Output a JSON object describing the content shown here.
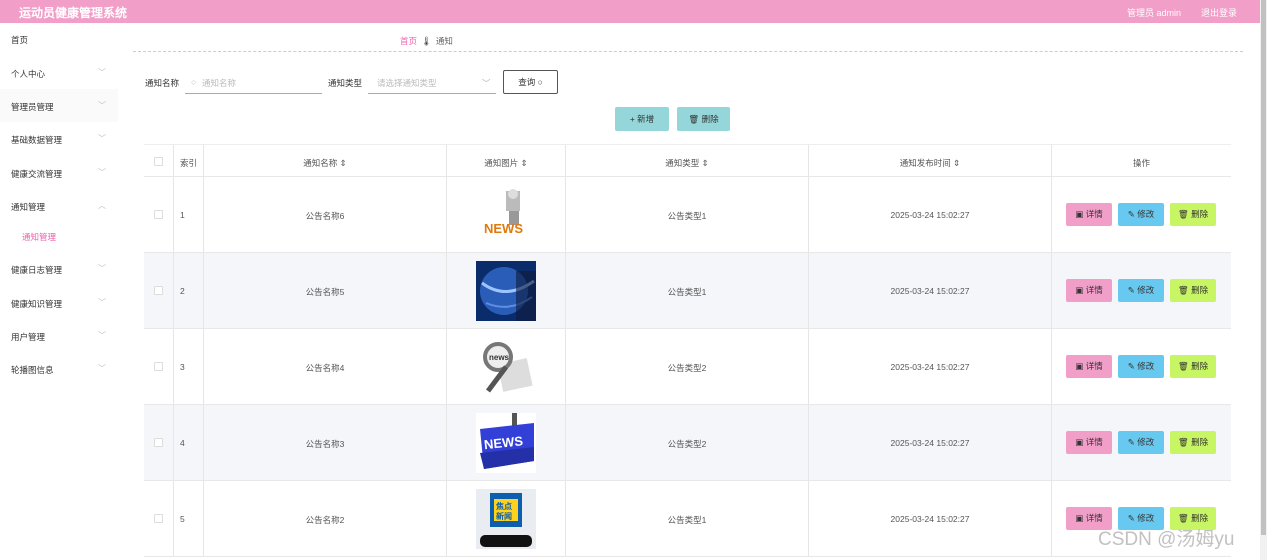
{
  "header": {
    "title": "运动员健康管理系统",
    "admin": "管理员 admin",
    "logout": "退出登录"
  },
  "sidebar": {
    "items": [
      {
        "label": "首页",
        "chev": ""
      },
      {
        "label": "个人中心",
        "chev": "﹀"
      },
      {
        "label": "管理员管理",
        "chev": "﹀"
      },
      {
        "label": "基础数据管理",
        "chev": "﹀"
      },
      {
        "label": "健康交流管理",
        "chev": "﹀"
      },
      {
        "label": "通知管理",
        "chev": "︿"
      },
      {
        "label": "健康日志管理",
        "chev": "﹀"
      },
      {
        "label": "健康知识管理",
        "chev": "﹀"
      },
      {
        "label": "用户管理",
        "chev": "﹀"
      },
      {
        "label": "轮播图信息",
        "chev": "﹀"
      }
    ],
    "sub_item": "通知管理"
  },
  "breadcrumb": {
    "home": "首页",
    "icon": "🌡",
    "current": "通知"
  },
  "search": {
    "name_label": "通知名称",
    "name_placeholder": "通知名称",
    "type_label": "通知类型",
    "type_placeholder": "请选择通知类型",
    "query_label": "查询",
    "search_icon": "○"
  },
  "actions": {
    "add_label": "新增",
    "add_icon": "+",
    "delete_label": "删除",
    "delete_icon": "🗑"
  },
  "table": {
    "columns": [
      "索引",
      "通知名称",
      "通知图片",
      "通知类型",
      "通知发布时间",
      "操作"
    ],
    "sort_icon": "⇕",
    "rows": [
      {
        "index": "1",
        "name": "公告名称6",
        "type": "公告类型1",
        "time": "2025-03-24 15:02:27",
        "image": "news-robot"
      },
      {
        "index": "2",
        "name": "公告名称5",
        "type": "公告类型1",
        "time": "2025-03-24 15:02:27",
        "image": "globe"
      },
      {
        "index": "3",
        "name": "公告名称4",
        "type": "公告类型2",
        "time": "2025-03-24 15:02:27",
        "image": "magnifier"
      },
      {
        "index": "4",
        "name": "公告名称3",
        "type": "公告类型2",
        "time": "2025-03-24 15:02:27",
        "image": "news-key"
      },
      {
        "index": "5",
        "name": "公告名称2",
        "type": "公告类型1",
        "time": "2025-03-24 15:02:27",
        "image": "phone-news"
      }
    ],
    "ops": {
      "detail": "详情",
      "edit": "修改",
      "remove": "删除"
    },
    "op_icons": {
      "detail": "▣",
      "edit": "✎",
      "remove": "🗑"
    }
  },
  "watermark": "CSDN @汤姆yu",
  "colors": {
    "brand": "#f19ec8",
    "accent": "#f063ad",
    "teal": "#94d6d9",
    "edit": "#68c9f0",
    "remove": "#c7f563"
  }
}
